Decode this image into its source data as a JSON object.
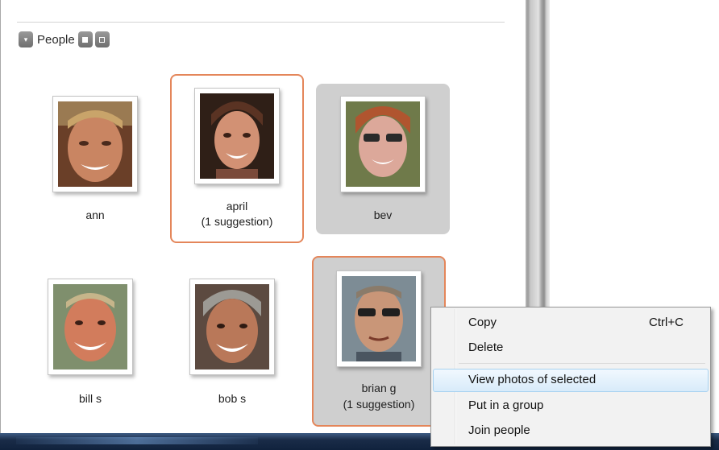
{
  "people_section": {
    "title": "People",
    "collapse_icon": "triangle-down-icon",
    "tile_view_icon": "square-filled-icon",
    "list_view_icon": "square-outline-icon"
  },
  "people": [
    {
      "name": "ann"
    },
    {
      "name": "april",
      "suggestion": "(1 suggestion)"
    },
    {
      "name": "bev"
    },
    {
      "name": "bill s"
    },
    {
      "name": "bob s"
    },
    {
      "name": "brian g",
      "suggestion": "(1 suggestion)"
    }
  ],
  "context_menu": {
    "items": [
      {
        "label": "Copy",
        "shortcut": "Ctrl+C"
      },
      {
        "label": "Delete"
      },
      {
        "label": "View photos of selected"
      },
      {
        "label": "Put in a group"
      },
      {
        "label": "Join people"
      }
    ]
  },
  "colors": {
    "selection_border": "#e4865a",
    "gray_selection": "#cfcfcf",
    "menu_hover": "#d8ebfa"
  }
}
